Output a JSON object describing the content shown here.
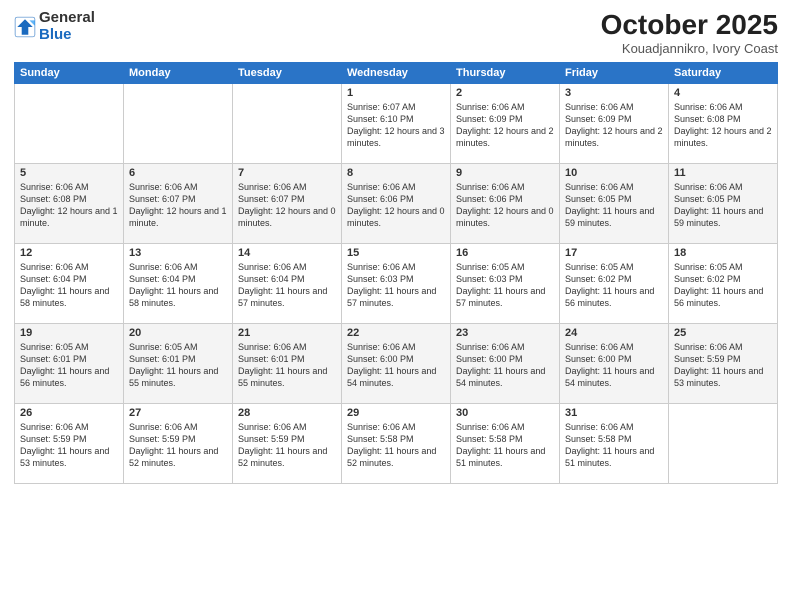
{
  "logo": {
    "general": "General",
    "blue": "Blue"
  },
  "header": {
    "month": "October 2025",
    "location": "Kouadjannikro, Ivory Coast"
  },
  "weekdays": [
    "Sunday",
    "Monday",
    "Tuesday",
    "Wednesday",
    "Thursday",
    "Friday",
    "Saturday"
  ],
  "weeks": [
    [
      {
        "day": "",
        "info": ""
      },
      {
        "day": "",
        "info": ""
      },
      {
        "day": "",
        "info": ""
      },
      {
        "day": "1",
        "info": "Sunrise: 6:07 AM\nSunset: 6:10 PM\nDaylight: 12 hours and 3 minutes."
      },
      {
        "day": "2",
        "info": "Sunrise: 6:06 AM\nSunset: 6:09 PM\nDaylight: 12 hours and 2 minutes."
      },
      {
        "day": "3",
        "info": "Sunrise: 6:06 AM\nSunset: 6:09 PM\nDaylight: 12 hours and 2 minutes."
      },
      {
        "day": "4",
        "info": "Sunrise: 6:06 AM\nSunset: 6:08 PM\nDaylight: 12 hours and 2 minutes."
      }
    ],
    [
      {
        "day": "5",
        "info": "Sunrise: 6:06 AM\nSunset: 6:08 PM\nDaylight: 12 hours and 1 minute."
      },
      {
        "day": "6",
        "info": "Sunrise: 6:06 AM\nSunset: 6:07 PM\nDaylight: 12 hours and 1 minute."
      },
      {
        "day": "7",
        "info": "Sunrise: 6:06 AM\nSunset: 6:07 PM\nDaylight: 12 hours and 0 minutes."
      },
      {
        "day": "8",
        "info": "Sunrise: 6:06 AM\nSunset: 6:06 PM\nDaylight: 12 hours and 0 minutes."
      },
      {
        "day": "9",
        "info": "Sunrise: 6:06 AM\nSunset: 6:06 PM\nDaylight: 12 hours and 0 minutes."
      },
      {
        "day": "10",
        "info": "Sunrise: 6:06 AM\nSunset: 6:05 PM\nDaylight: 11 hours and 59 minutes."
      },
      {
        "day": "11",
        "info": "Sunrise: 6:06 AM\nSunset: 6:05 PM\nDaylight: 11 hours and 59 minutes."
      }
    ],
    [
      {
        "day": "12",
        "info": "Sunrise: 6:06 AM\nSunset: 6:04 PM\nDaylight: 11 hours and 58 minutes."
      },
      {
        "day": "13",
        "info": "Sunrise: 6:06 AM\nSunset: 6:04 PM\nDaylight: 11 hours and 58 minutes."
      },
      {
        "day": "14",
        "info": "Sunrise: 6:06 AM\nSunset: 6:04 PM\nDaylight: 11 hours and 57 minutes."
      },
      {
        "day": "15",
        "info": "Sunrise: 6:06 AM\nSunset: 6:03 PM\nDaylight: 11 hours and 57 minutes."
      },
      {
        "day": "16",
        "info": "Sunrise: 6:05 AM\nSunset: 6:03 PM\nDaylight: 11 hours and 57 minutes."
      },
      {
        "day": "17",
        "info": "Sunrise: 6:05 AM\nSunset: 6:02 PM\nDaylight: 11 hours and 56 minutes."
      },
      {
        "day": "18",
        "info": "Sunrise: 6:05 AM\nSunset: 6:02 PM\nDaylight: 11 hours and 56 minutes."
      }
    ],
    [
      {
        "day": "19",
        "info": "Sunrise: 6:05 AM\nSunset: 6:01 PM\nDaylight: 11 hours and 56 minutes."
      },
      {
        "day": "20",
        "info": "Sunrise: 6:05 AM\nSunset: 6:01 PM\nDaylight: 11 hours and 55 minutes."
      },
      {
        "day": "21",
        "info": "Sunrise: 6:06 AM\nSunset: 6:01 PM\nDaylight: 11 hours and 55 minutes."
      },
      {
        "day": "22",
        "info": "Sunrise: 6:06 AM\nSunset: 6:00 PM\nDaylight: 11 hours and 54 minutes."
      },
      {
        "day": "23",
        "info": "Sunrise: 6:06 AM\nSunset: 6:00 PM\nDaylight: 11 hours and 54 minutes."
      },
      {
        "day": "24",
        "info": "Sunrise: 6:06 AM\nSunset: 6:00 PM\nDaylight: 11 hours and 54 minutes."
      },
      {
        "day": "25",
        "info": "Sunrise: 6:06 AM\nSunset: 5:59 PM\nDaylight: 11 hours and 53 minutes."
      }
    ],
    [
      {
        "day": "26",
        "info": "Sunrise: 6:06 AM\nSunset: 5:59 PM\nDaylight: 11 hours and 53 minutes."
      },
      {
        "day": "27",
        "info": "Sunrise: 6:06 AM\nSunset: 5:59 PM\nDaylight: 11 hours and 52 minutes."
      },
      {
        "day": "28",
        "info": "Sunrise: 6:06 AM\nSunset: 5:59 PM\nDaylight: 11 hours and 52 minutes."
      },
      {
        "day": "29",
        "info": "Sunrise: 6:06 AM\nSunset: 5:58 PM\nDaylight: 11 hours and 52 minutes."
      },
      {
        "day": "30",
        "info": "Sunrise: 6:06 AM\nSunset: 5:58 PM\nDaylight: 11 hours and 51 minutes."
      },
      {
        "day": "31",
        "info": "Sunrise: 6:06 AM\nSunset: 5:58 PM\nDaylight: 11 hours and 51 minutes."
      },
      {
        "day": "",
        "info": ""
      }
    ]
  ]
}
